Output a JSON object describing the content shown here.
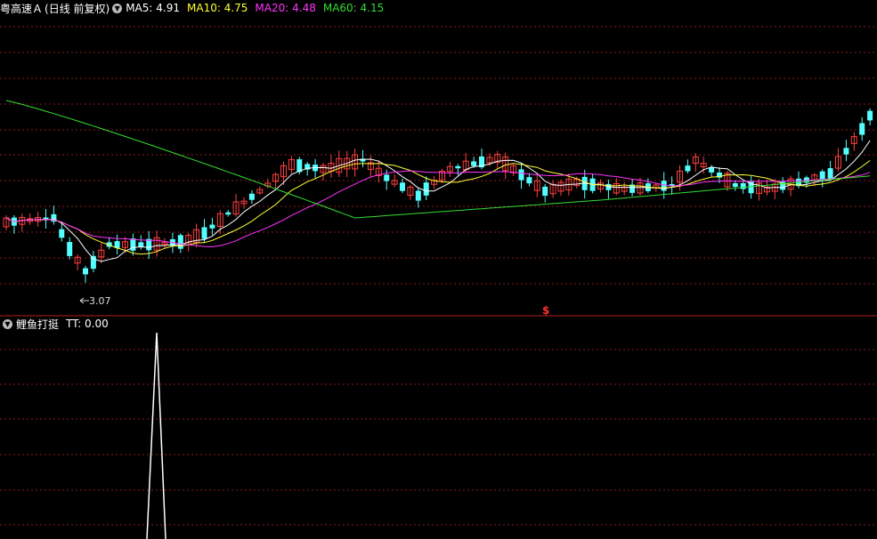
{
  "header": {
    "stock_name": "粤高速Ａ",
    "period": "(日线 前复权)",
    "ma": [
      {
        "label": "MA5:",
        "value": "4.91",
        "color": "#ffffff"
      },
      {
        "label": "MA10:",
        "value": "4.75",
        "color": "#ffff33"
      },
      {
        "label": "MA20:",
        "value": "4.48",
        "color": "#ff33ff"
      },
      {
        "label": "MA60:",
        "value": "4.15",
        "color": "#33dd33"
      }
    ]
  },
  "indicator": {
    "name": "鲤鱼打挺",
    "tt_label": "TT:",
    "tt_value": "0.00"
  },
  "annotations": {
    "low_price": "3.07",
    "signal_mark": "$"
  },
  "colors": {
    "up": "#ff4040",
    "down": "#54ffff",
    "grid": "#8b1a1a",
    "ma5": "#ffffff",
    "ma10": "#ffff33",
    "ma20": "#ff33ff",
    "ma60": "#33dd33",
    "indicator": "#ffffff"
  }
}
